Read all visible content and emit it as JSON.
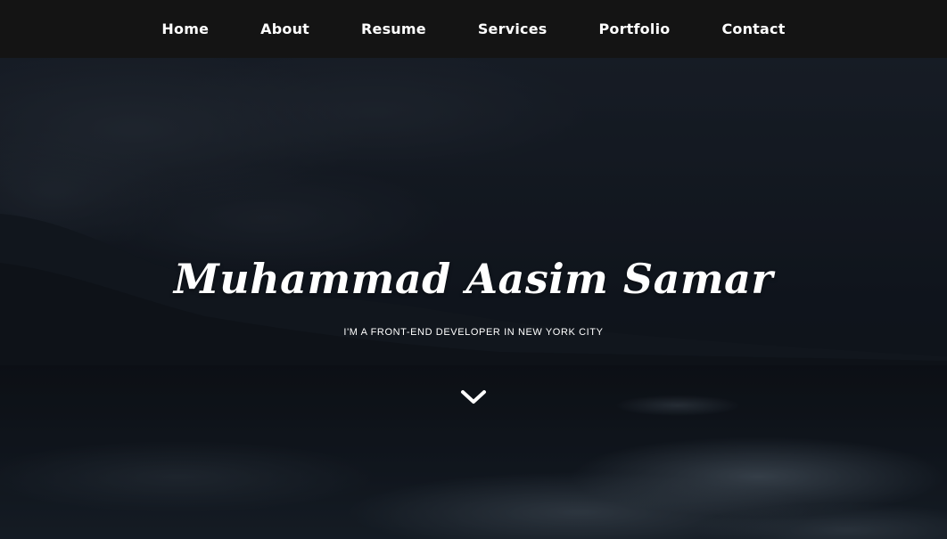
{
  "nav": {
    "items": [
      {
        "label": "Home"
      },
      {
        "label": "About"
      },
      {
        "label": "Resume"
      },
      {
        "label": "Services"
      },
      {
        "label": "Portfolio"
      },
      {
        "label": "Contact"
      }
    ]
  },
  "hero": {
    "title": "Muhammad Aasim Samar",
    "subtitle": "I'M A FRONT-END DEVELOPER IN NEW YORK CITY",
    "scroll_icon": "chevron-down-icon"
  },
  "colors": {
    "nav_bg": "#141414",
    "text": "#ffffff",
    "hero_sky": "#1b232d",
    "hero_sea": "#0d1419"
  }
}
